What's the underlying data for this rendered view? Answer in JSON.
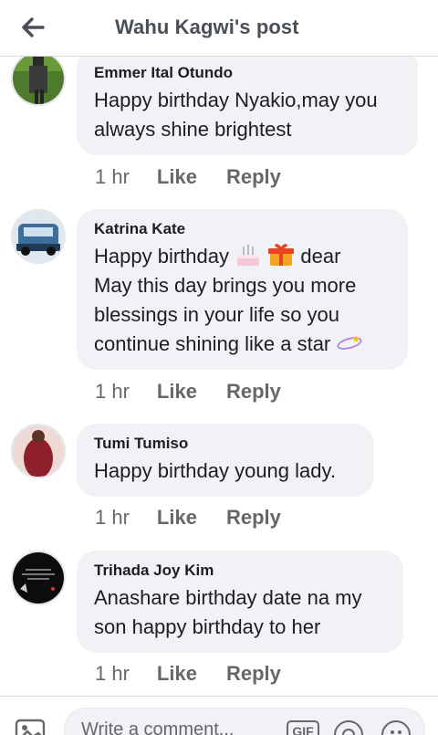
{
  "header": {
    "title": "Wahu Kagwi's post",
    "back_icon": "back-arrow-icon"
  },
  "comments": [
    {
      "author": "Emmer Ital Otundo",
      "lines": [
        "Happy birthday Nyakio,may you",
        "always shine brightest"
      ],
      "time": "1 hr",
      "like": "Like",
      "reply": "Reply"
    },
    {
      "author": "Katrina Kate",
      "line1_prefix": "Happy birthday",
      "line1_suffix": "dear",
      "lines_rest": [
        "May this day brings you more",
        "blessings in your life so you",
        "continue shining like a star"
      ],
      "emojis": [
        "birthday-cake-icon",
        "gift-icon",
        "dizzy-star-icon"
      ],
      "time": "1 hr",
      "like": "Like",
      "reply": "Reply"
    },
    {
      "author": "Tumi Tumiso",
      "lines": [
        "Happy birthday young lady."
      ],
      "time": "1 hr",
      "like": "Like",
      "reply": "Reply"
    },
    {
      "author": "Trihada Joy Kim",
      "lines": [
        "Anashare birthday date na my",
        "son happy birthday to her"
      ],
      "time": "1 hr",
      "like": "Like",
      "reply": "Reply"
    }
  ],
  "composer": {
    "placeholder": "Write a comment...",
    "gif_label": "GIF"
  },
  "colors": {
    "bubble": "#f0f2f5",
    "meta_text": "#65676b",
    "title_text": "#4b4f56"
  }
}
